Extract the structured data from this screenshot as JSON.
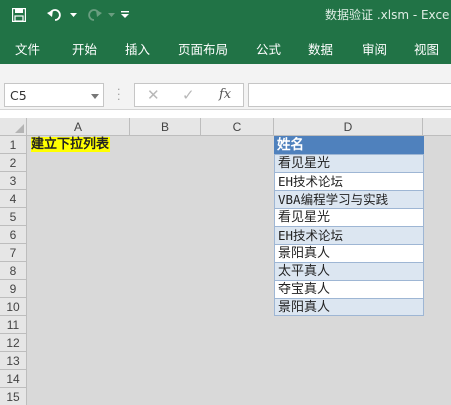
{
  "titlebar": {
    "doc_title": "数据验证 .xlsm  -  Exce"
  },
  "ribbon": {
    "tabs": [
      "文件",
      "开始",
      "插入",
      "页面布局",
      "公式",
      "数据",
      "审阅",
      "视图"
    ]
  },
  "formula_bar": {
    "name_box": "C5",
    "cancel_glyph": "✕",
    "enter_glyph": "✓",
    "fx_label": "fx",
    "formula_value": ""
  },
  "grid": {
    "columns": [
      "A",
      "B",
      "C",
      "D"
    ],
    "rows": [
      "1",
      "2",
      "3",
      "4",
      "5",
      "6",
      "7",
      "8",
      "9",
      "10",
      "11",
      "12",
      "13",
      "14",
      "15"
    ],
    "a1_text": "建立下拉列表",
    "table": {
      "header": "姓名",
      "values": [
        "看见星光",
        "EH技术论坛",
        "VBA编程学习与实践",
        "看见星光",
        "EH技术论坛",
        "景阳真人",
        "太平真人",
        "夺宝真人",
        "景阳真人"
      ]
    }
  },
  "colors": {
    "brand_green": "#217346",
    "table_header": "#4f81bd",
    "table_band": "#dce6f1",
    "highlight_yellow": "#ffff00"
  }
}
